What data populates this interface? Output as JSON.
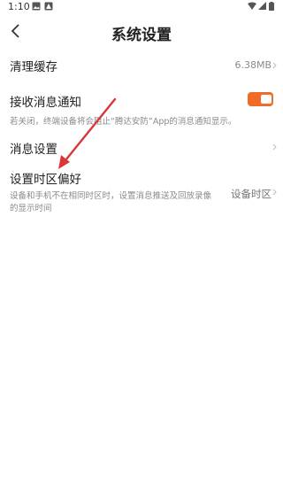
{
  "status_bar": {
    "time": "1:10",
    "icons": [
      "image-notification-icon",
      "app-notification-icon",
      "wifi-icon",
      "signal-icon",
      "battery-icon"
    ]
  },
  "header": {
    "title": "系统设置",
    "back_icon": "chevron-left-icon"
  },
  "settings": {
    "clear_cache": {
      "label": "清理缓存",
      "value": "6.38MB"
    },
    "notification": {
      "label": "接收消息通知",
      "enabled": true,
      "description": "若关闭，终端设备将会阻止“腾达安防”App的消息通知显示。"
    },
    "message_settings": {
      "label": "消息设置"
    },
    "timezone": {
      "label": "设置时区偏好",
      "value": "设备时区",
      "description_line1": "设备和手机不在相同时区时，设置消息推送及回放录像",
      "description_line2": "的显示时间"
    }
  },
  "colors": {
    "toggle_on": "#f06a28",
    "annotation_arrow": "#d9373a",
    "secondary_text": "#8a8a8a"
  }
}
